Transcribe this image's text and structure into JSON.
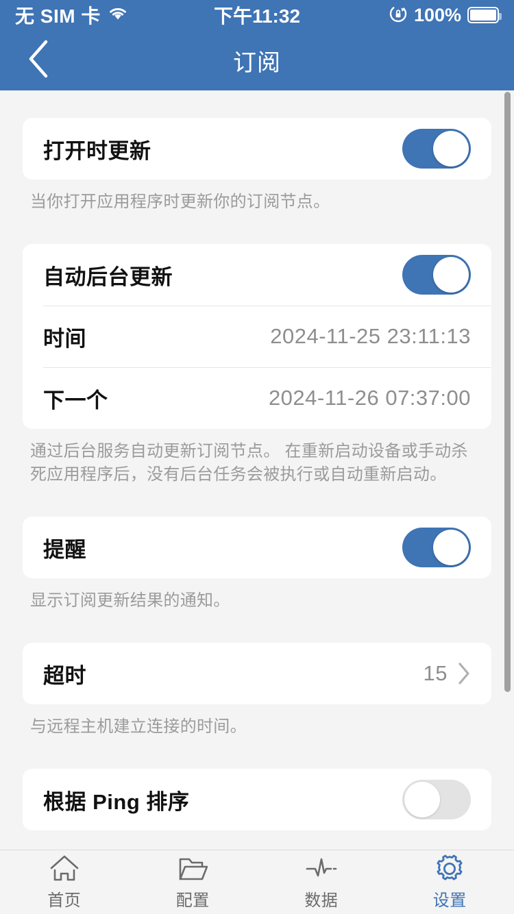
{
  "colors": {
    "brand_blue": "#3f74b5",
    "page_bg": "#f4f4f4",
    "card_bg": "#ffffff",
    "muted_text": "#9b9b9b",
    "toggle_off": "#e3e3e3"
  },
  "status_bar": {
    "carrier": "无 SIM 卡",
    "wifi_icon": "wifi-icon",
    "time": "下午11:32",
    "rotation_lock_icon": "rotation-lock-icon",
    "battery_percent": "100%",
    "battery_icon": "battery-full-icon"
  },
  "nav_bar": {
    "back_icon": "chevron-left-icon",
    "title": "订阅"
  },
  "sections": [
    {
      "rows": [
        {
          "label": "打开时更新",
          "control": "toggle",
          "state": "on"
        }
      ],
      "footnote": "当你打开应用程序时更新你的订阅节点。"
    },
    {
      "rows": [
        {
          "label": "自动后台更新",
          "control": "toggle",
          "state": "on"
        },
        {
          "label": "时间",
          "control": "value",
          "value": "2024-11-25 23:11:13"
        },
        {
          "label": "下一个",
          "control": "value",
          "value": "2024-11-26 07:37:00"
        }
      ],
      "footnote": "通过后台服务自动更新订阅节点。 在重新启动设备或手动杀死应用程序后，没有后台任务会被执行或自动重新启动。"
    },
    {
      "rows": [
        {
          "label": "提醒",
          "control": "toggle",
          "state": "on"
        }
      ],
      "footnote": "显示订阅更新结果的通知。"
    },
    {
      "rows": [
        {
          "label": "超时",
          "control": "disclosure",
          "value": "15",
          "chevron_icon": "chevron-right-icon"
        }
      ],
      "footnote": "与远程主机建立连接的时间。"
    },
    {
      "rows": [
        {
          "label": "根据 Ping 排序",
          "control": "toggle",
          "state": "off"
        }
      ],
      "footnote": ""
    }
  ],
  "scrollbar": {
    "visible": true
  },
  "tab_bar": {
    "active_index": 3,
    "tabs": [
      {
        "label": "首页",
        "icon": "home-icon"
      },
      {
        "label": "配置",
        "icon": "folder-icon"
      },
      {
        "label": "数据",
        "icon": "pulse-icon"
      },
      {
        "label": "设置",
        "icon": "gear-icon"
      }
    ]
  }
}
